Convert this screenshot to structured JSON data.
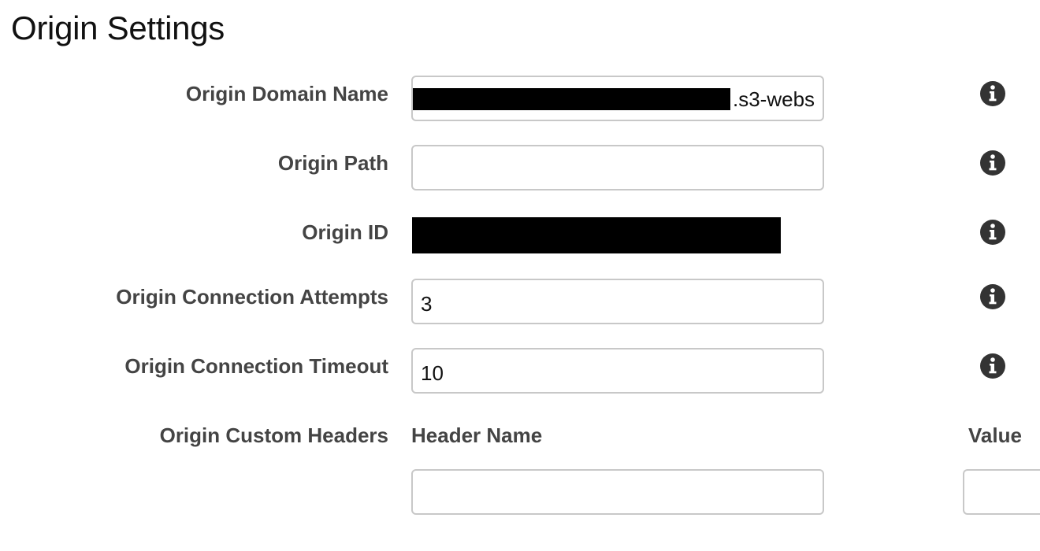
{
  "section_title": "Origin Settings",
  "fields": {
    "origin_domain_name": {
      "label": "Origin Domain Name",
      "value_suffix": ".s3-webs"
    },
    "origin_path": {
      "label": "Origin Path",
      "value": ""
    },
    "origin_id": {
      "label": "Origin ID"
    },
    "origin_connection_attempts": {
      "label": "Origin Connection Attempts",
      "value": "3"
    },
    "origin_connection_timeout": {
      "label": "Origin Connection Timeout",
      "value": "10"
    },
    "origin_custom_headers": {
      "label": "Origin Custom Headers",
      "header_name_column": "Header Name",
      "value_column": "Value",
      "header_name_value": "",
      "header_value_value": ""
    }
  },
  "icons": {
    "info": "info-icon"
  },
  "colors": {
    "label_text": "#444444",
    "input_border": "#c8c8c8",
    "info_icon": "#333333",
    "redaction": "#000000"
  }
}
